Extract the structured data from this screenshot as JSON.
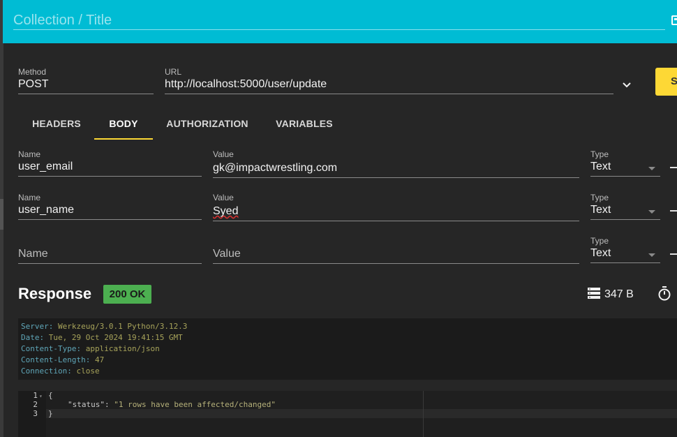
{
  "header": {
    "title_placeholder": "Collection / Title"
  },
  "request": {
    "method_label": "Method",
    "method": "POST",
    "url_label": "URL",
    "url": "http://localhost:5000/user/update",
    "send_label": "S"
  },
  "tabs": [
    {
      "label": "HEADERS"
    },
    {
      "label": "BODY"
    },
    {
      "label": "AUTHORIZATION"
    },
    {
      "label": "VARIABLES"
    }
  ],
  "body_rows": [
    {
      "name_label": "Name",
      "name": "user_email",
      "value_label": "Value",
      "value": "gk@impactwrestling.com",
      "type_label": "Type",
      "type": "Text"
    },
    {
      "name_label": "Name",
      "name": "user_name",
      "value_label": "Value",
      "value": "Syed",
      "type_label": "Type",
      "type": "Text"
    },
    {
      "name_placeholder": "Name",
      "value_placeholder": "Value",
      "type_label": "Type",
      "type": "Text"
    }
  ],
  "response": {
    "title": "Response",
    "status": "200 OK",
    "size": "347 B",
    "headers": [
      {
        "key": "Server",
        "value": "Werkzeug/3.0.1 Python/3.12.3"
      },
      {
        "key": "Date",
        "value": "Tue, 29 Oct 2024 19:41:15 GMT"
      },
      {
        "key": "Content-Type",
        "value": "application/json"
      },
      {
        "key": "Content-Length",
        "value": "47"
      },
      {
        "key": "Connection",
        "value": "close"
      }
    ],
    "body_lines": [
      "1",
      "2",
      "3"
    ],
    "body": {
      "open": "{",
      "key": "\"status\"",
      "sep": ": ",
      "value": "\"1 rows have been affected/changed\"",
      "close": "}"
    }
  },
  "colors": {
    "header": "#00bcd4",
    "accent": "#fdd835",
    "status": "#4caf50",
    "background": "#262626"
  }
}
